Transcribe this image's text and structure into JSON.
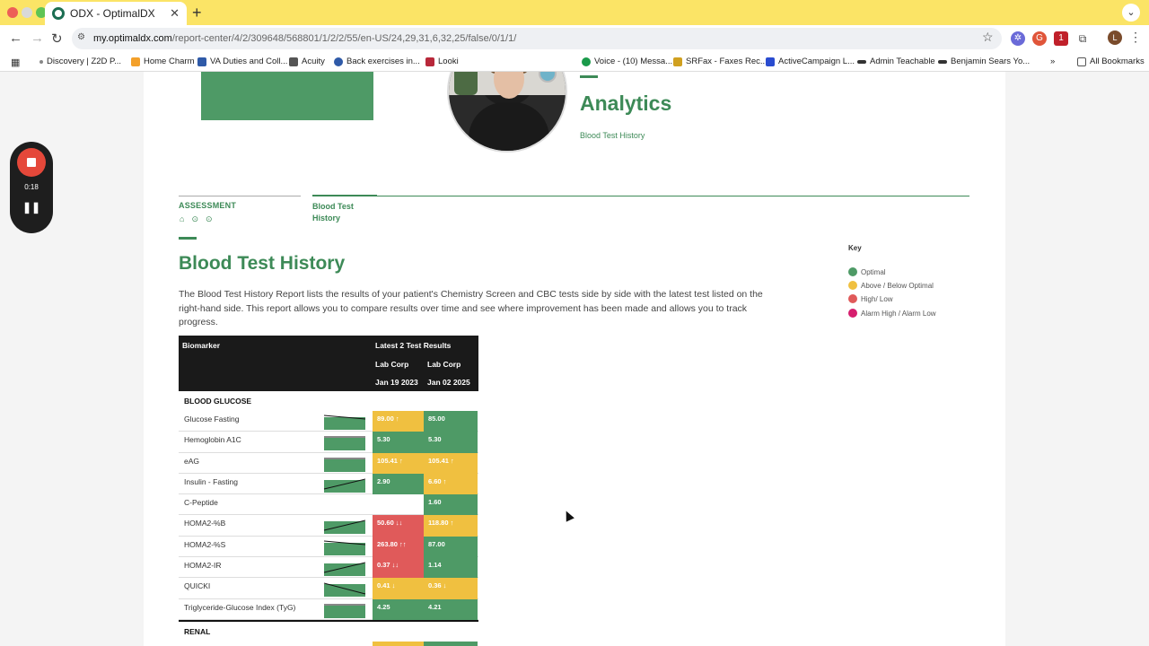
{
  "colors": {
    "optimal": "#4e9a66",
    "above_below": "#f0c040",
    "high_low": "#e05a5a",
    "alarm": "#d61e6e",
    "brand_green": "#3d8a57"
  },
  "browser": {
    "tab_title": "ODX - OptimalDX",
    "url_domain": "my.optimaldx.com",
    "url_path": "/report-center/4/2/309648/568801/1/2/2/55/en-US/24,29,31,6,32,25/false/0/1/1/"
  },
  "bookmarks": [
    {
      "label": "Discovery | Z2D P...",
      "icon": "dot-icon",
      "color": "#888"
    },
    {
      "label": "Home Charm",
      "icon": "home-charm-icon",
      "color": "#f3a02a"
    },
    {
      "label": "VA Duties and Coll...",
      "icon": "va-icon",
      "color": "#2f5aa8"
    },
    {
      "label": "Acuity",
      "icon": "acuity-icon",
      "color": "#555"
    },
    {
      "label": "Back exercises in...",
      "icon": "back-icon",
      "color": "#2f5aa8"
    },
    {
      "label": "Looki",
      "icon": "lb-icon",
      "color": "#b8283a"
    },
    {
      "label": "Voice - (10) Messa...",
      "icon": "phone-icon",
      "color": "#1a9a4a"
    },
    {
      "label": "SRFax - Faxes Rec...",
      "icon": "srfax-icon",
      "color": "#d0a020"
    },
    {
      "label": "ActiveCampaign L...",
      "icon": "activecampaign-icon",
      "color": "#2a4cd0"
    },
    {
      "label": "Admin Teachable",
      "icon": "teachable-icon",
      "color": "#333"
    },
    {
      "label": "Benjamin Sears Yo...",
      "icon": "youtube-icon",
      "color": "#333"
    }
  ],
  "bookmarks_all": "All Bookmarks",
  "recorder": {
    "time": "0:18"
  },
  "header": {
    "analytics_title": "Analytics",
    "analytics_sub": "Blood Test History"
  },
  "tabs": {
    "assessment": "ASSESSMENT",
    "blood_test_history": "Blood Test History"
  },
  "page": {
    "title": "Blood Test History",
    "intro": "The Blood Test History Report lists the results of your patient's Chemistry Screen and CBC tests side by side with the latest test listed on the right-hand side. This report allows you to compare results over time and see where improvement has been made and allows you to track progress."
  },
  "key": {
    "title": "Key",
    "items": [
      {
        "label": "Optimal",
        "color": "#4e9a66"
      },
      {
        "label": "Above / Below Optimal",
        "color": "#f0c040"
      },
      {
        "label": "High/ Low",
        "color": "#e05a5a"
      },
      {
        "label": "Alarm High / Alarm Low",
        "color": "#d61e6e"
      }
    ]
  },
  "table": {
    "col_biomarker": "Biomarker",
    "col_results": "Latest 2 Test Results",
    "lab1": "Lab Corp",
    "lab2": "Lab Corp",
    "date1": "Jan 19 2023",
    "date2": "Jan 02 2025",
    "section": "BLOOD GLUCOSE",
    "next_section": "RENAL",
    "rows": [
      {
        "name": "Glucose Fasting",
        "v1": "89.00 ↑",
        "s1": "above_below",
        "v2": "85.00",
        "s2": "optimal",
        "trend": "down"
      },
      {
        "name": "Hemoglobin A1C",
        "v1": "5.30",
        "s1": "optimal",
        "v2": "5.30",
        "s2": "optimal",
        "trend": "flat"
      },
      {
        "name": "eAG",
        "v1": "105.41 ↑",
        "s1": "above_below",
        "v2": "105.41 ↑",
        "s2": "above_below",
        "trend": "flat"
      },
      {
        "name": "Insulin - Fasting",
        "v1": "2.90",
        "s1": "optimal",
        "v2": "6.60 ↑",
        "s2": "above_below",
        "trend": "up"
      },
      {
        "name": "C-Peptide",
        "v1": "",
        "s1": "none",
        "v2": "1.60",
        "s2": "optimal",
        "trend": "none"
      },
      {
        "name": "HOMA2-%B",
        "v1": "50.60 ↓↓",
        "s1": "high_low",
        "v2": "118.80 ↑",
        "s2": "above_below",
        "trend": "up"
      },
      {
        "name": "HOMA2-%S",
        "v1": "263.80 ↑↑",
        "s1": "high_low",
        "v2": "87.00",
        "s2": "optimal",
        "trend": "down"
      },
      {
        "name": "HOMA2-IR",
        "v1": "0.37 ↓↓",
        "s1": "high_low",
        "v2": "1.14",
        "s2": "optimal",
        "trend": "up"
      },
      {
        "name": "QUICKI",
        "v1": "0.41 ↓",
        "s1": "above_below",
        "v2": "0.36 ↓",
        "s2": "above_below",
        "trend": "flat-low"
      },
      {
        "name": "Triglyceride-Glucose Index (TyG)",
        "v1": "4.25",
        "s1": "optimal",
        "v2": "4.21",
        "s2": "optimal",
        "trend": "flat"
      }
    ]
  }
}
